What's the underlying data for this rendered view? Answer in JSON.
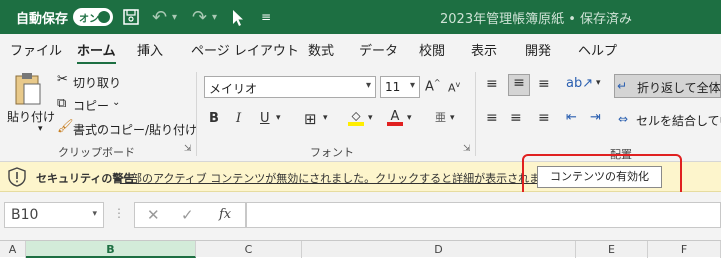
{
  "titlebar": {
    "autosave_label": "自動保存",
    "autosave_toggle": "オン",
    "document_title": "2023年管理帳簿原紙 • 保存済み",
    "bg_color": "#1d6f42"
  },
  "tabs": [
    "ファイル",
    "ホーム",
    "挿入",
    "ページ レイアウト",
    "数式",
    "データ",
    "校閲",
    "表示",
    "開発",
    "ヘルプ"
  ],
  "active_tab": "ホーム",
  "ribbon": {
    "clipboard": {
      "paste_label": "貼り付け",
      "cut_label": "切り取り",
      "copy_label": "コピー",
      "format_painter_label": "書式のコピー/貼り付け",
      "group_label": "クリップボード"
    },
    "font": {
      "font_name": "メイリオ",
      "font_size": "11",
      "group_label": "フォント"
    },
    "alignment": {
      "wrap_text_label": "折り返して全体を",
      "merge_label": "セルを結合して中",
      "group_label": "配置"
    }
  },
  "security_bar": {
    "title": "セキュリティの警告",
    "message": "一部のアクティブ コンテンツが無効にされました。クリックすると詳細が表示されます。",
    "enable_button": "コンテンツの有効化",
    "highlight_color": "#e02020"
  },
  "formula_bar": {
    "name_box": "B10",
    "fx_label": "fx",
    "formula": ""
  },
  "columns": [
    "A",
    "B",
    "C",
    "D",
    "E",
    "F"
  ],
  "selected_column": "B"
}
